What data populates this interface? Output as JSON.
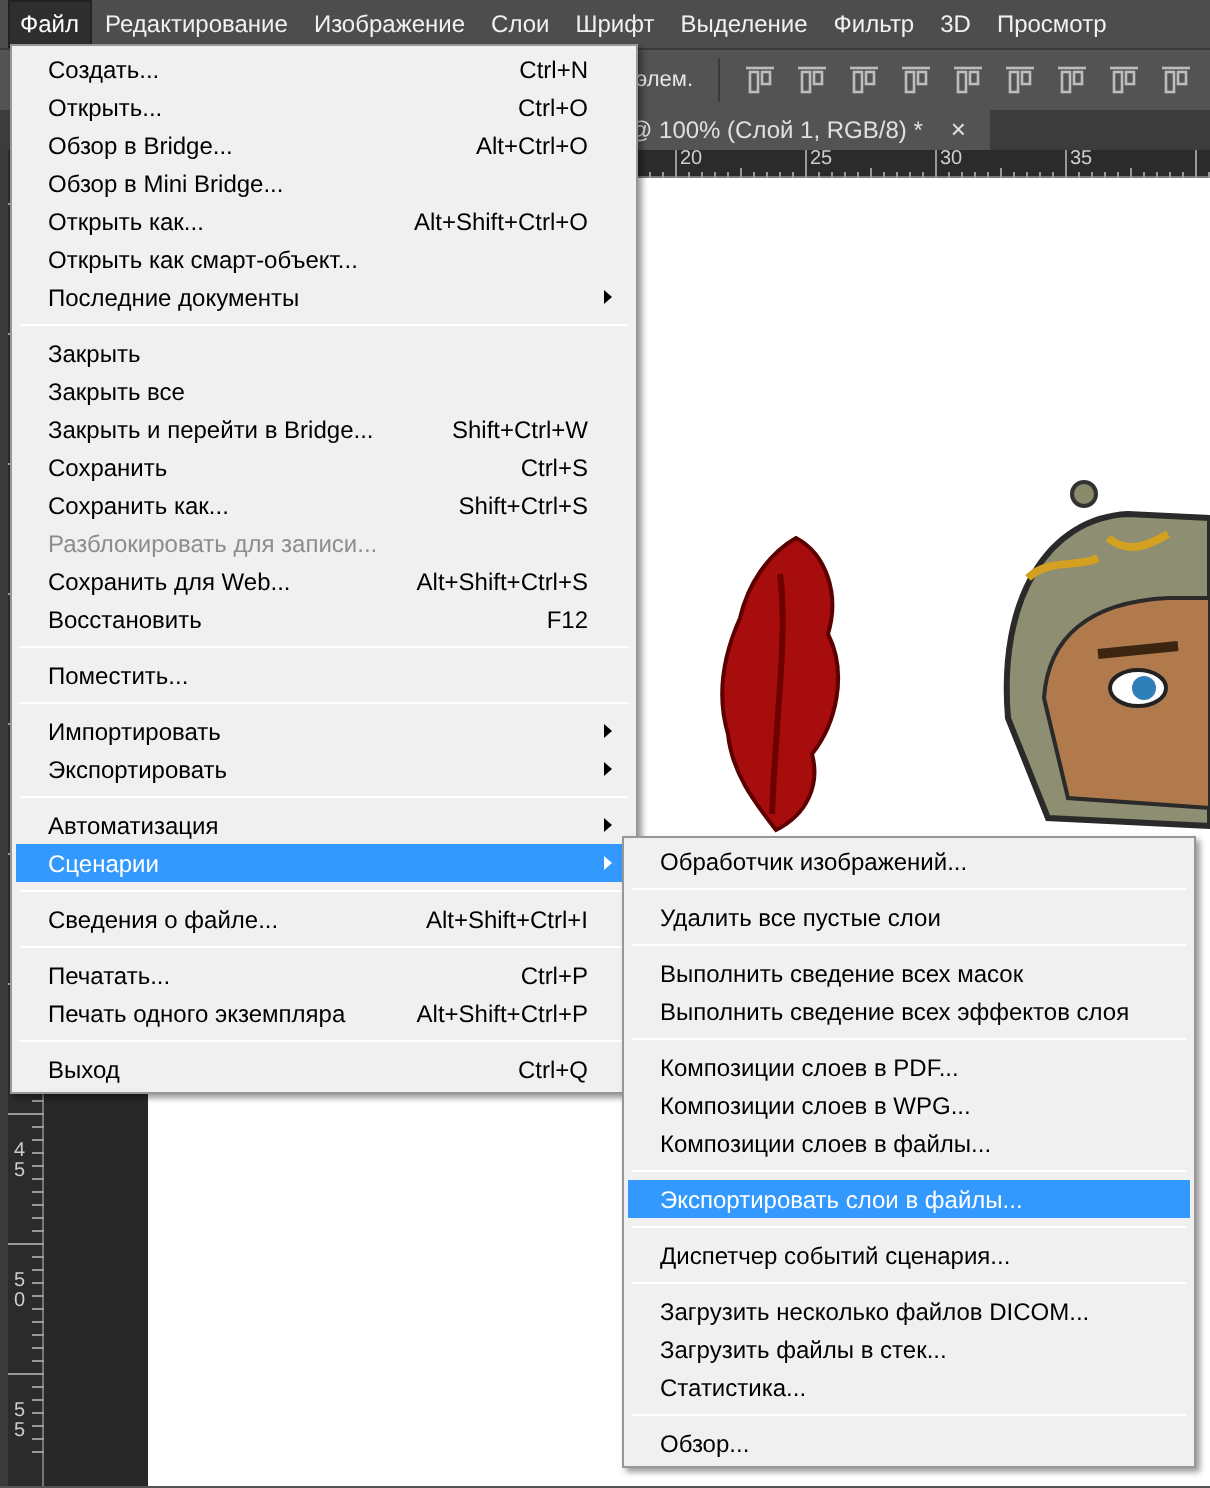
{
  "menu_bar": [
    {
      "label": "Файл",
      "selected": true
    },
    {
      "label": "Редактирование",
      "selected": false
    },
    {
      "label": "Изображение",
      "selected": false
    },
    {
      "label": "Слои",
      "selected": false
    },
    {
      "label": "Шрифт",
      "selected": false
    },
    {
      "label": "Выделение",
      "selected": false
    },
    {
      "label": "Фильтр",
      "selected": false
    },
    {
      "label": "3D",
      "selected": false
    },
    {
      "label": "Просмотр",
      "selected": false
    }
  ],
  "options_bar": {
    "label": "элем."
  },
  "document_tab": {
    "title": "@ 100% (Слой 1, RGB/8) *",
    "close": "×"
  },
  "horizontal_ruler": [
    "20",
    "25",
    "30",
    "35"
  ],
  "vertical_ruler": [
    "45",
    "50",
    "55"
  ],
  "file_menu": [
    {
      "kind": "item",
      "label": "Создать...",
      "shortcut": "Ctrl+N",
      "has_submenu": false,
      "disabled": false,
      "selected": false
    },
    {
      "kind": "item",
      "label": "Открыть...",
      "shortcut": "Ctrl+O",
      "has_submenu": false,
      "disabled": false,
      "selected": false
    },
    {
      "kind": "item",
      "label": "Обзор в Bridge...",
      "shortcut": "Alt+Ctrl+O",
      "has_submenu": false,
      "disabled": false,
      "selected": false
    },
    {
      "kind": "item",
      "label": "Обзор в Mini Bridge...",
      "has_submenu": false,
      "disabled": false,
      "selected": false
    },
    {
      "kind": "item",
      "label": "Открыть как...",
      "shortcut": "Alt+Shift+Ctrl+O",
      "has_submenu": false,
      "disabled": false,
      "selected": false
    },
    {
      "kind": "item",
      "label": "Открыть как смарт-объект...",
      "has_submenu": false,
      "disabled": false,
      "selected": false
    },
    {
      "kind": "item",
      "label": "Последние документы",
      "has_submenu": true,
      "disabled": false,
      "selected": false
    },
    {
      "kind": "separator"
    },
    {
      "kind": "item",
      "label": "Закрыть",
      "has_submenu": false,
      "disabled": false,
      "selected": false
    },
    {
      "kind": "item",
      "label": "Закрыть все",
      "has_submenu": false,
      "disabled": false,
      "selected": false
    },
    {
      "kind": "item",
      "label": "Закрыть и перейти в Bridge...",
      "shortcut": "Shift+Ctrl+W",
      "has_submenu": false,
      "disabled": false,
      "selected": false
    },
    {
      "kind": "item",
      "label": "Сохранить",
      "shortcut": "Ctrl+S",
      "has_submenu": false,
      "disabled": false,
      "selected": false
    },
    {
      "kind": "item",
      "label": "Сохранить как...",
      "shortcut": "Shift+Ctrl+S",
      "has_submenu": false,
      "disabled": false,
      "selected": false
    },
    {
      "kind": "item",
      "label": "Разблокировать для записи...",
      "has_submenu": false,
      "disabled": true,
      "selected": false
    },
    {
      "kind": "item",
      "label": "Сохранить для Web...",
      "shortcut": "Alt+Shift+Ctrl+S",
      "has_submenu": false,
      "disabled": false,
      "selected": false
    },
    {
      "kind": "item",
      "label": "Восстановить",
      "shortcut": "F12",
      "has_submenu": false,
      "disabled": false,
      "selected": false
    },
    {
      "kind": "separator"
    },
    {
      "kind": "item",
      "label": "Поместить...",
      "has_submenu": false,
      "disabled": false,
      "selected": false
    },
    {
      "kind": "separator"
    },
    {
      "kind": "item",
      "label": "Импортировать",
      "has_submenu": true,
      "disabled": false,
      "selected": false
    },
    {
      "kind": "item",
      "label": "Экспортировать",
      "has_submenu": true,
      "disabled": false,
      "selected": false
    },
    {
      "kind": "separator"
    },
    {
      "kind": "item",
      "label": "Автоматизация",
      "has_submenu": true,
      "disabled": false,
      "selected": false
    },
    {
      "kind": "item",
      "label": "Сценарии",
      "has_submenu": true,
      "disabled": false,
      "selected": true
    },
    {
      "kind": "separator"
    },
    {
      "kind": "item",
      "label": "Сведения о файле...",
      "shortcut": "Alt+Shift+Ctrl+I",
      "has_submenu": false,
      "disabled": false,
      "selected": false
    },
    {
      "kind": "separator"
    },
    {
      "kind": "item",
      "label": "Печатать...",
      "shortcut": "Ctrl+P",
      "has_submenu": false,
      "disabled": false,
      "selected": false
    },
    {
      "kind": "item",
      "label": "Печать одного экземпляра",
      "shortcut": "Alt+Shift+Ctrl+P",
      "has_submenu": false,
      "disabled": false,
      "selected": false
    },
    {
      "kind": "separator"
    },
    {
      "kind": "item",
      "label": "Выход",
      "shortcut": "Ctrl+Q",
      "has_submenu": false,
      "disabled": false,
      "selected": false
    }
  ],
  "scripts_submenu": [
    {
      "kind": "item",
      "label": "Обработчик изображений...",
      "selected": false
    },
    {
      "kind": "separator"
    },
    {
      "kind": "item",
      "label": "Удалить все пустые слои",
      "selected": false
    },
    {
      "kind": "separator"
    },
    {
      "kind": "item",
      "label": "Выполнить сведение всех масок",
      "selected": false
    },
    {
      "kind": "item",
      "label": "Выполнить сведение всех эффектов слоя",
      "selected": false
    },
    {
      "kind": "separator"
    },
    {
      "kind": "item",
      "label": "Композиции слоев в PDF...",
      "selected": false
    },
    {
      "kind": "item",
      "label": "Композиции слоев в WPG...",
      "selected": false
    },
    {
      "kind": "item",
      "label": "Композиции слоев в файлы...",
      "selected": false
    },
    {
      "kind": "separator"
    },
    {
      "kind": "item",
      "label": "Экспортировать слои в файлы...",
      "selected": true
    },
    {
      "kind": "separator"
    },
    {
      "kind": "item",
      "label": "Диспетчер событий сценария...",
      "selected": false
    },
    {
      "kind": "separator"
    },
    {
      "kind": "item",
      "label": "Загрузить несколько файлов DICOM...",
      "selected": false
    },
    {
      "kind": "item",
      "label": "Загрузить файлы в стек...",
      "selected": false
    },
    {
      "kind": "item",
      "label": "Статистика...",
      "selected": false
    },
    {
      "kind": "separator"
    },
    {
      "kind": "item",
      "label": "Обзор...",
      "selected": false
    }
  ]
}
